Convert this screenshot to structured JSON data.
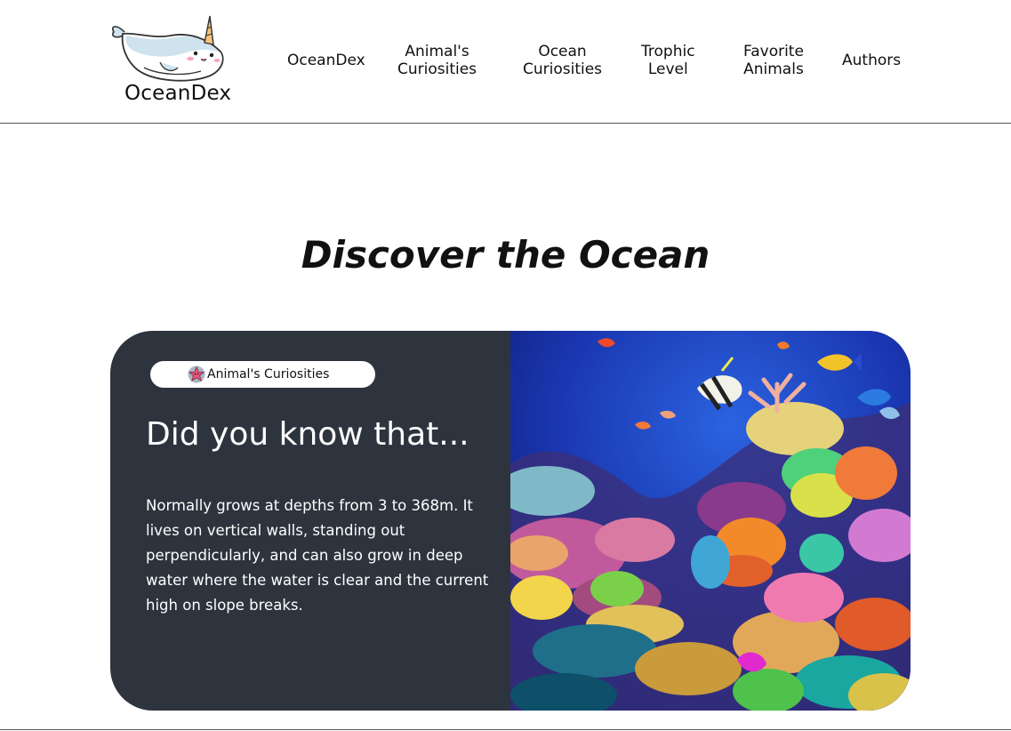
{
  "logo": {
    "text": "OceanDex",
    "icon": "narwhal-logo-icon"
  },
  "nav": {
    "items": [
      {
        "label": "OceanDex"
      },
      {
        "label": "Animal's\nCuriosities"
      },
      {
        "label": "Ocean\nCuriosities"
      },
      {
        "label": "Trophic\nLevel"
      },
      {
        "label": "Favorite\nAnimals"
      },
      {
        "label": "Authors"
      }
    ]
  },
  "main": {
    "title": "Discover the Ocean",
    "card": {
      "badge": {
        "label": "Animal's Curiosities",
        "icon": "starfish-icon"
      },
      "heading": "Did you know that...",
      "text": "Normally grows at depths from 3 to 368m. It lives on vertical walls, standing out perpendicularly, and can also grow in deep water where the water is clear and the current high on slope breaks.",
      "image": "coral-reef-photo"
    }
  },
  "colors": {
    "card_bg": "#2d343e",
    "ocean_blue": "#1b2fa0",
    "text_dark": "#111111",
    "white": "#ffffff"
  }
}
